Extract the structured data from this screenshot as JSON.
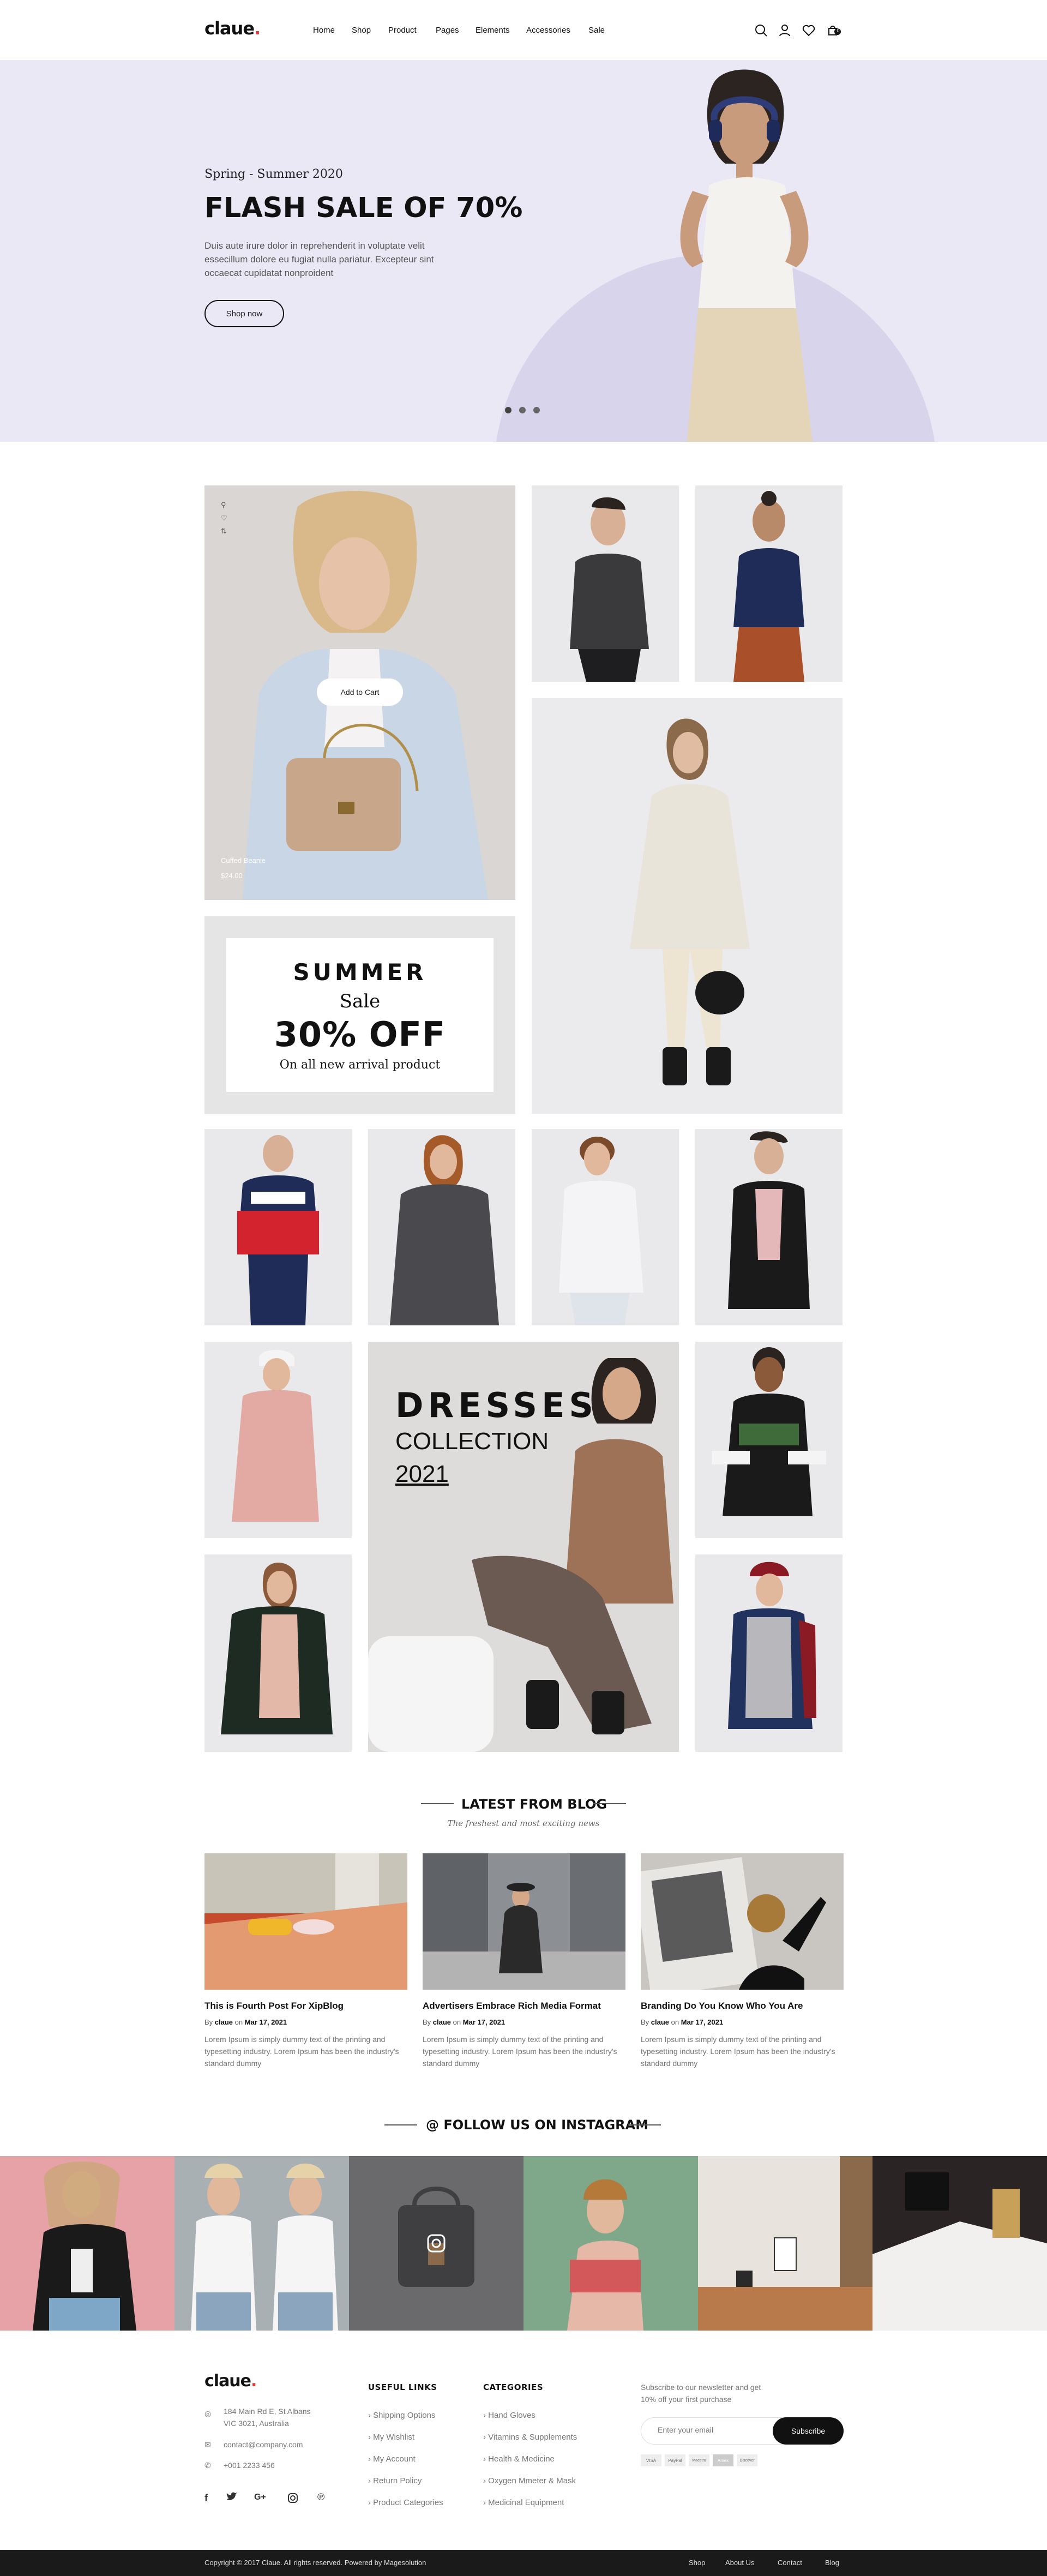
{
  "header": {
    "logo": "claue",
    "nav": [
      "Home",
      "Shop",
      "Product",
      "Pages",
      "Elements",
      "Accessories",
      "Sale"
    ],
    "cart_count": "0",
    "icons": [
      "search-icon",
      "user-icon",
      "heart-icon",
      "cart-icon"
    ]
  },
  "hero": {
    "subtitle": "Spring - Summer 2020",
    "title": "FLASH SALE OF 70%",
    "description": "Duis aute irure dolor in reprehenderit in voluptate velit essecillum dolore eu fugiat nulla pariatur. Excepteur sint occaecat cupidatat nonproident",
    "button": "Shop now",
    "slides": 3,
    "active_slide": 1
  },
  "products": {
    "featured": {
      "name": "Cuffed Beanie",
      "price": "$24.00",
      "add_to_cart": "Add to Cart"
    }
  },
  "promo": {
    "line1": "SUMMER",
    "line2": "Sale",
    "line3": "30% OFF",
    "line4": "On all new arrival product"
  },
  "dresses": {
    "line1": "DRESSES",
    "line2": "COLLECTION",
    "line3": "2021"
  },
  "blog": {
    "title": "LATEST FROM BLOG",
    "subtitle": "The freshest and most exciting news",
    "posts": [
      {
        "title": "This is Fourth Post For XipBlog",
        "by": "By",
        "author": "claue",
        "on": "on",
        "date": "Mar 17, 2021",
        "excerpt": "Lorem Ipsum is simply dummy text of the printing and typesetting industry. Lorem Ipsum has been the industry's standard dummy"
      },
      {
        "title": "Advertisers Embrace Rich Media Format",
        "by": "By",
        "author": "claue",
        "on": "on",
        "date": "Mar 17, 2021",
        "excerpt": "Lorem Ipsum is simply dummy text of the printing and typesetting industry. Lorem Ipsum has been the industry's standard dummy"
      },
      {
        "title": "Branding Do You Know Who You Are",
        "by": "By",
        "author": "claue",
        "on": "on",
        "date": "Mar 17, 2021",
        "excerpt": "Lorem Ipsum is simply dummy text of the printing and typesetting industry. Lorem Ipsum has been the industry's standard dummy"
      }
    ]
  },
  "instagram": {
    "title": "@ FOLLOW US ON INSTAGRAM"
  },
  "footer": {
    "logo": "claue",
    "address": [
      "184 Main Rd E, St Albans",
      "VIC 3021, Australia"
    ],
    "email": "contact@company.com",
    "phone": "+001 2233 456",
    "social": [
      "facebook-icon",
      "twitter-icon",
      "google-plus-icon",
      "instagram-icon",
      "pinterest-icon"
    ],
    "useful_links_title": "USEFUL LINKS",
    "useful_links": [
      "Shipping Options",
      "My Wishlist",
      "My Account",
      "Return Policy",
      "Product Categories"
    ],
    "categories_title": "CATEGORIES",
    "categories": [
      "Hand Gloves",
      "Vitamins & Supplements",
      "Health & Medicine",
      "Oxygen Mmeter & Mask",
      "Medicinal Equipment"
    ],
    "newsletter_text": [
      "Subscribe to our newsletter and get",
      "10% off your first purchase"
    ],
    "newsletter_placeholder": "Enter your email",
    "subscribe": "Subscribe",
    "payments": [
      "VISA",
      "PayPal",
      "Maestro",
      "Amex",
      "Discover"
    ]
  },
  "bottom": {
    "copyright": "Copyright © 2017 Claue. All rights reserved. Powered by Magesolution",
    "links": [
      "Shop",
      "About Us",
      "Contact",
      "Blog"
    ]
  }
}
